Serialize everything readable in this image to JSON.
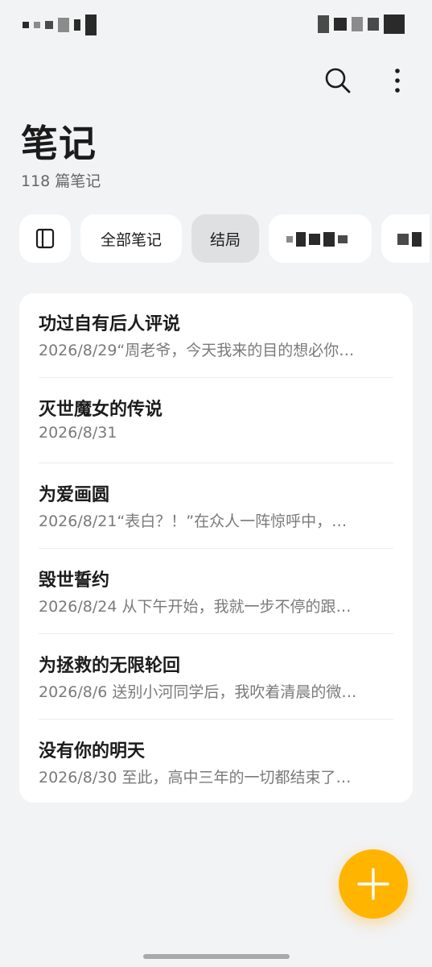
{
  "header": {
    "title": "笔记",
    "count_text": "118 篇笔记"
  },
  "toolbar": {
    "search_icon": "search-icon",
    "more_icon": "more-vertical-icon"
  },
  "filters": {
    "sidebar_toggle_icon": "sidebar-panel-icon",
    "chips": [
      {
        "label": "全部笔记",
        "selected": false
      },
      {
        "label": "结局",
        "selected": true
      }
    ]
  },
  "notes": [
    {
      "title": "功过自有后人评说",
      "date": "2026/8/29",
      "preview": "“周老爷，今天我来的目的想必你…"
    },
    {
      "title": "灭世魔女的传说",
      "date": "2026/8/31",
      "preview": ""
    },
    {
      "title": "为爱画圆",
      "date": "2026/8/21",
      "preview": "“表白？！”在众人一阵惊呼中，…"
    },
    {
      "title": "毁世誓约",
      "date": "2026/8/24",
      "preview": "从下午开始，我就一步不停的跟…"
    },
    {
      "title": "为拯救的无限轮回",
      "date": "2026/8/6",
      "preview": "送别小河同学后，我吹着清晨的微…"
    },
    {
      "title": "没有你的明天",
      "date": "2026/8/30",
      "preview": "至此，高中三年的一切都结束了…"
    }
  ],
  "fab": {
    "icon": "plus-icon"
  },
  "colors": {
    "accent": "#ffb400",
    "background": "#f2f3f5",
    "card": "#ffffff",
    "chip_selected": "#dfe0e2"
  }
}
